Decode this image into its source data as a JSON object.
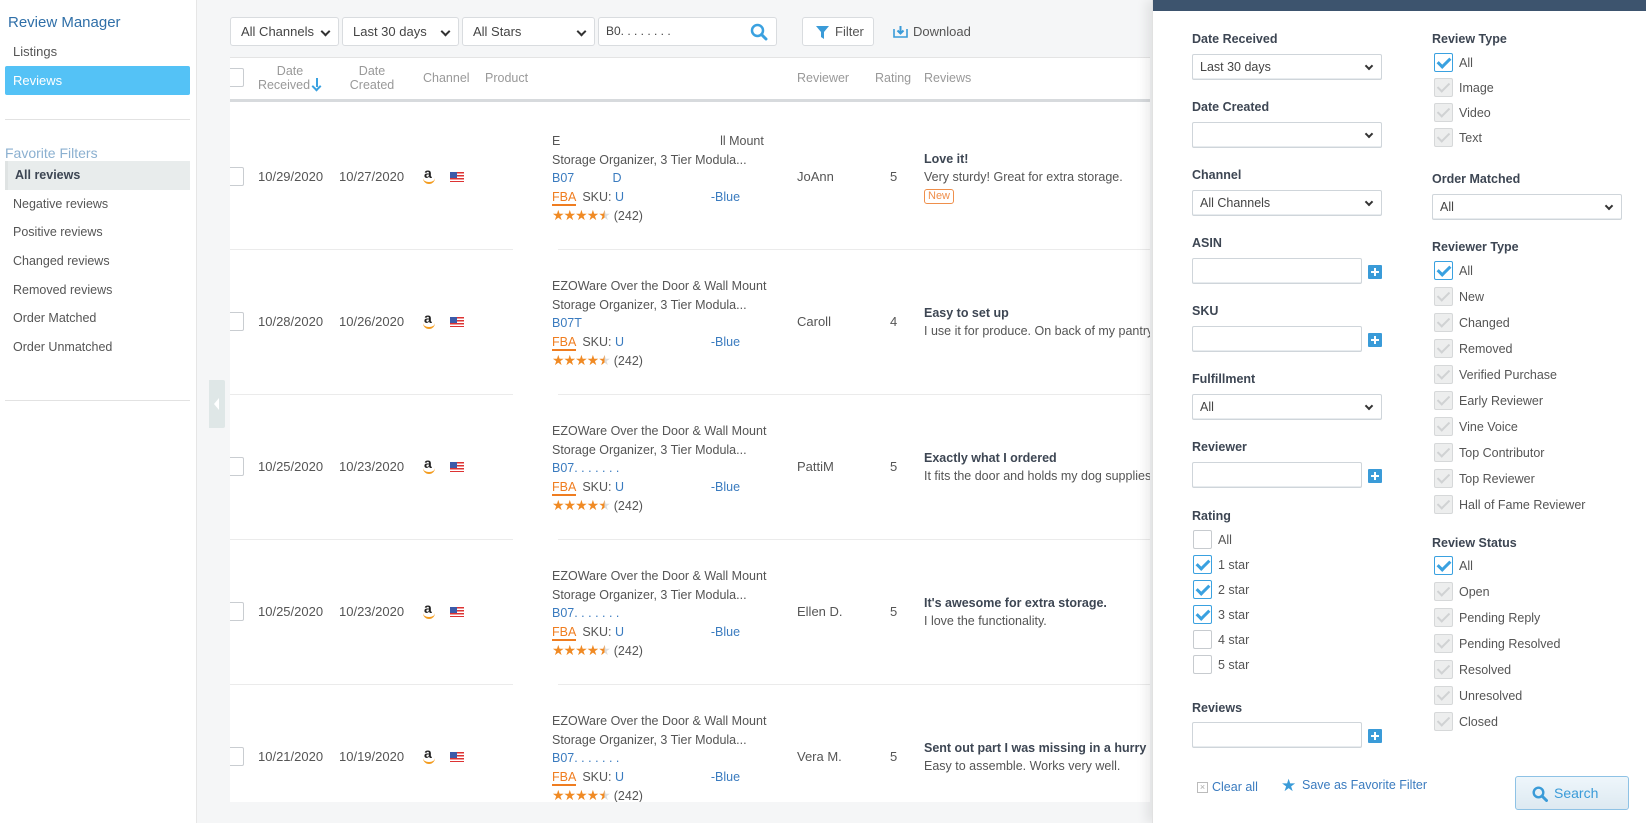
{
  "sidebar": {
    "title": "Review Manager",
    "nav": [
      {
        "label": "Listings",
        "active": false
      },
      {
        "label": "Reviews",
        "active": true
      }
    ],
    "favorites_title": "Favorite Filters",
    "favorites": [
      {
        "label": "All reviews",
        "selected": true
      },
      {
        "label": "Negative reviews"
      },
      {
        "label": "Positive reviews"
      },
      {
        "label": "Changed reviews"
      },
      {
        "label": "Removed reviews"
      },
      {
        "label": "Order Matched"
      },
      {
        "label": "Order Unmatched"
      }
    ]
  },
  "toolbar": {
    "channel_select": "All Channels",
    "date_select": "Last 30 days",
    "stars_select": "All Stars",
    "search_value": "B0. . . . . . . .",
    "filter_label": "Filter",
    "download_label": "Download"
  },
  "table": {
    "columns": {
      "date_received": [
        "Date",
        "Received"
      ],
      "date_created": [
        "Date",
        "Created"
      ],
      "channel": "Channel",
      "product": "Product",
      "reviewer": "Reviewer",
      "rating": "Rating",
      "reviews": "Reviews"
    },
    "rows": [
      {
        "date_received": "10/29/2020",
        "date_created": "10/27/2020",
        "channel": "amazon",
        "country": "US",
        "product_line1": "E                                              ll Mount",
        "product_line2": "Storage Organizer, 3 Tier Modula...",
        "asin": "B07           D",
        "fulfillment": "FBA",
        "sku_label": "SKU:",
        "sku_value": "U                         -Blue",
        "product_rating_count": "(242)",
        "reviewer": "JoAnn",
        "rating": "5",
        "review_title": "Love it!",
        "review_body": "Very sturdy! Great for extra storage.",
        "badge": "New"
      },
      {
        "date_received": "10/28/2020",
        "date_created": "10/26/2020",
        "channel": "amazon",
        "country": "US",
        "product_line1": "EZOWare Over the Door & Wall Mount",
        "product_line2": "Storage Organizer, 3 Tier Modula...",
        "asin": "B07T",
        "fulfillment": "FBA",
        "sku_label": "SKU:",
        "sku_value": "U                         -Blue",
        "product_rating_count": "(242)",
        "reviewer": "Caroll",
        "rating": "4",
        "review_title": "Easy to set up",
        "review_body": "I use it for produce. On back of my pantry door.",
        "badge": ""
      },
      {
        "date_received": "10/25/2020",
        "date_created": "10/23/2020",
        "channel": "amazon",
        "country": "US",
        "product_line1": "EZOWare Over the Door & Wall Mount",
        "product_line2": "Storage Organizer, 3 Tier Modula...",
        "asin": "B07. . . . . . .",
        "fulfillment": "FBA",
        "sku_label": "SKU:",
        "sku_value": "U                         -Blue",
        "product_rating_count": "(242)",
        "reviewer": "PattiM",
        "rating": "5",
        "review_title": "Exactly what I ordered",
        "review_body": "It fits the door and holds my dog supplies.",
        "badge": ""
      },
      {
        "date_received": "10/25/2020",
        "date_created": "10/23/2020",
        "channel": "amazon",
        "country": "US",
        "product_line1": "EZOWare Over the Door & Wall Mount",
        "product_line2": "Storage Organizer, 3 Tier Modula...",
        "asin": "B07. . . . . . .",
        "fulfillment": "FBA",
        "sku_label": "SKU:",
        "sku_value": "U                         -Blue",
        "product_rating_count": "(242)",
        "reviewer": "Ellen D.",
        "rating": "5",
        "review_title": "It's awesome for extra storage.",
        "review_body": "I love the functionality.",
        "badge": ""
      },
      {
        "date_received": "10/21/2020",
        "date_created": "10/19/2020",
        "channel": "amazon",
        "country": "US",
        "product_line1": "EZOWare Over the Door & Wall Mount",
        "product_line2": "Storage Organizer, 3 Tier Modula...",
        "asin": "B07. . . . . . .",
        "fulfillment": "FBA",
        "sku_label": "SKU:",
        "sku_value": "U                         -Blue",
        "product_rating_count": "(242)",
        "reviewer": "Vera M.",
        "rating": "5",
        "review_title": "Sent out part I was missing in a hurry",
        "review_body": "Easy to assemble. Works very well.",
        "badge": ""
      }
    ]
  },
  "filter_panel": {
    "date_received": {
      "label": "Date Received",
      "value": "Last 30 days"
    },
    "date_created": {
      "label": "Date Created",
      "value": ""
    },
    "channel": {
      "label": "Channel",
      "value": "All Channels"
    },
    "asin": {
      "label": "ASIN",
      "value": ""
    },
    "sku": {
      "label": "SKU",
      "value": ""
    },
    "fulfillment": {
      "label": "Fulfillment",
      "value": "All"
    },
    "reviewer": {
      "label": "Reviewer",
      "value": ""
    },
    "rating": {
      "label": "Rating",
      "options": [
        {
          "label": "All",
          "checked": false
        },
        {
          "label": "1 star",
          "checked": true
        },
        {
          "label": "2 star",
          "checked": true
        },
        {
          "label": "3 star",
          "checked": true
        },
        {
          "label": "4 star",
          "checked": false
        },
        {
          "label": "5 star",
          "checked": false
        }
      ]
    },
    "reviews": {
      "label": "Reviews",
      "value": ""
    },
    "review_type": {
      "label": "Review Type",
      "options": [
        {
          "label": "All",
          "checked": true
        },
        {
          "label": "Image",
          "checked": false,
          "disabled": true
        },
        {
          "label": "Video",
          "checked": false,
          "disabled": true
        },
        {
          "label": "Text",
          "checked": false,
          "disabled": true
        }
      ]
    },
    "order_matched": {
      "label": "Order Matched",
      "value": "All"
    },
    "reviewer_type": {
      "label": "Reviewer Type",
      "options": [
        {
          "label": "All",
          "checked": true
        },
        {
          "label": "New",
          "disabled": true
        },
        {
          "label": "Changed",
          "disabled": true
        },
        {
          "label": "Removed",
          "disabled": true
        },
        {
          "label": "Verified Purchase",
          "disabled": true
        },
        {
          "label": "Early Reviewer",
          "disabled": true
        },
        {
          "label": "Vine Voice",
          "disabled": true
        },
        {
          "label": "Top Contributor",
          "disabled": true
        },
        {
          "label": "Top Reviewer",
          "disabled": true
        },
        {
          "label": "Hall of Fame Reviewer",
          "disabled": true
        }
      ]
    },
    "review_status": {
      "label": "Review Status",
      "options": [
        {
          "label": "All",
          "checked": true
        },
        {
          "label": "Open",
          "disabled": true
        },
        {
          "label": "Pending Reply",
          "disabled": true
        },
        {
          "label": "Pending Resolved",
          "disabled": true
        },
        {
          "label": "Resolved",
          "disabled": true
        },
        {
          "label": "Unresolved",
          "disabled": true
        },
        {
          "label": "Closed",
          "disabled": true
        }
      ]
    },
    "clear_all_label": "Clear all",
    "save_favorite_label": "Save as Favorite Filter",
    "search_label": "Search"
  },
  "colors": {
    "accent": "#54c2f6",
    "link": "#3a7bbf",
    "panel_header": "#3d546e",
    "fba_orange": "#ef7d20",
    "star_orange": "#f08a24"
  }
}
